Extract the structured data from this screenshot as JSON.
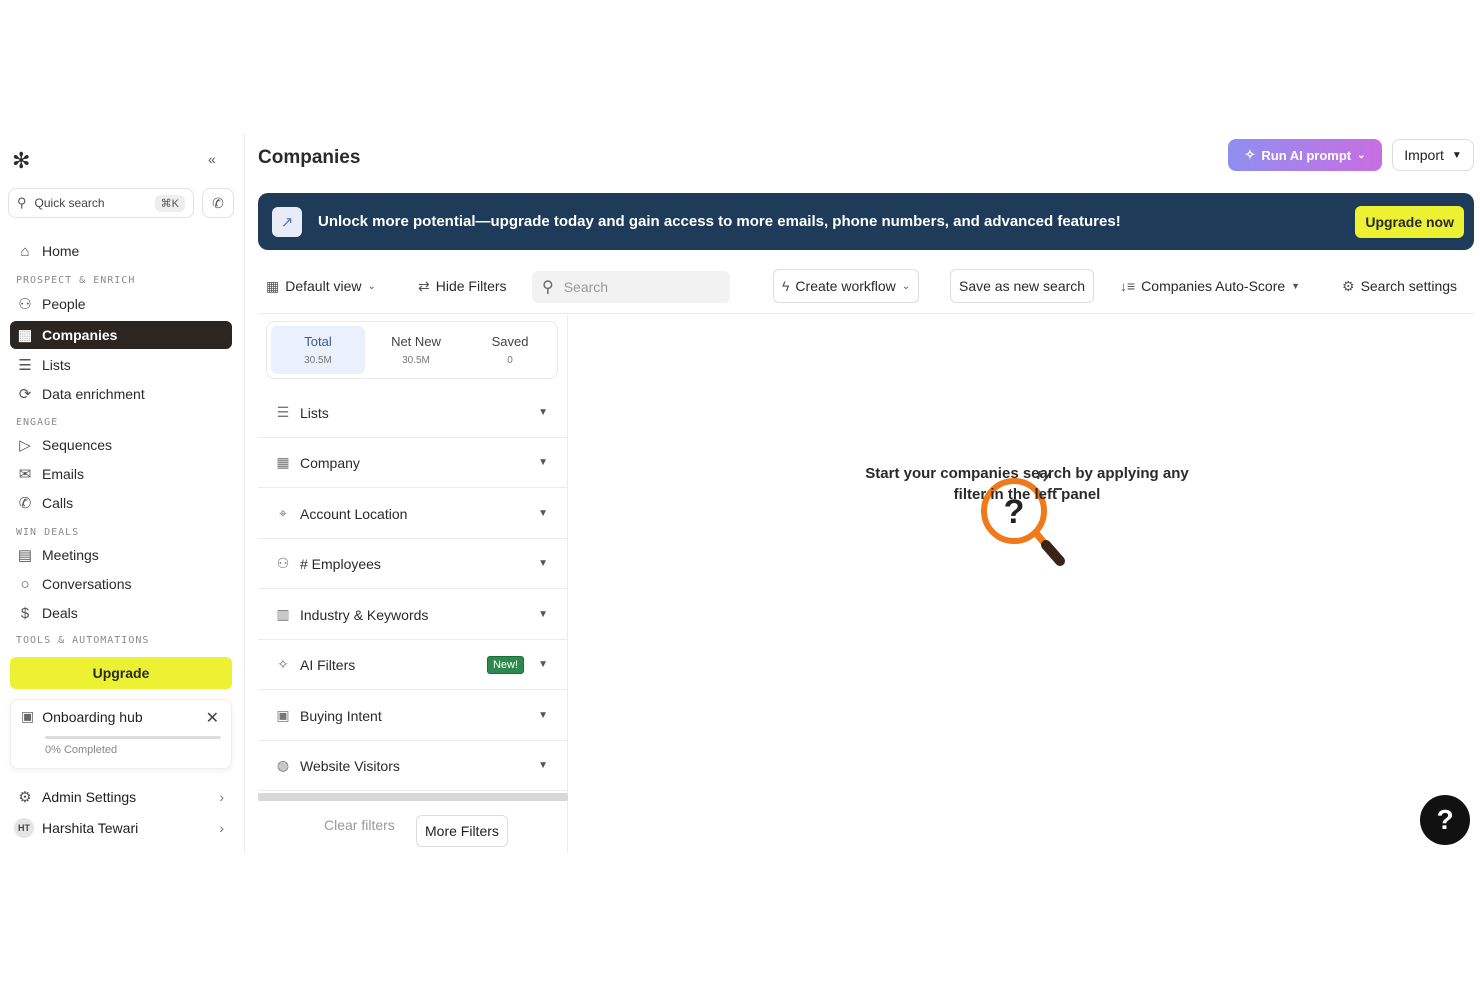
{
  "sidebar": {
    "collapse_icon": "«",
    "quick_search": {
      "placeholder": "Quick search",
      "shortcut": "⌘K"
    },
    "home": "Home",
    "sections": {
      "prospect": "PROSPECT & ENRICH",
      "engage": "ENGAGE",
      "win": "WIN DEALS",
      "tools": "TOOLS & AUTOMATIONS"
    },
    "items": {
      "people": "People",
      "companies": "Companies",
      "lists": "Lists",
      "data_enrichment": "Data enrichment",
      "sequences": "Sequences",
      "emails": "Emails",
      "calls": "Calls",
      "meetings": "Meetings",
      "conversations": "Conversations",
      "deals": "Deals"
    },
    "upgrade": "Upgrade",
    "onboarding": {
      "title": "Onboarding hub",
      "progress": "0% Completed",
      "progress_value": 0
    },
    "admin_settings": "Admin Settings",
    "user": {
      "initials": "HT",
      "name": "Harshita Tewari"
    }
  },
  "header": {
    "title": "Companies",
    "run_ai": "Run AI prompt",
    "import": "Import"
  },
  "banner": {
    "text": "Unlock more potential—upgrade today and gain access to more emails, phone numbers, and advanced features!",
    "button": "Upgrade now"
  },
  "toolbar": {
    "default_view": "Default view",
    "hide_filters": "Hide Filters",
    "search_placeholder": "Search",
    "create_workflow": "Create workflow",
    "save_search": "Save as new search",
    "auto_score": "Companies Auto-Score",
    "search_settings": "Search settings"
  },
  "stats": [
    {
      "label": "Total",
      "value": "30.5M"
    },
    {
      "label": "Net New",
      "value": "30.5M"
    },
    {
      "label": "Saved",
      "value": "0"
    }
  ],
  "filters": [
    {
      "label": "Lists",
      "icon": "list-icon"
    },
    {
      "label": "Company",
      "icon": "building-icon"
    },
    {
      "label": "Account Location",
      "icon": "location-pin-icon"
    },
    {
      "label": "# Employees",
      "icon": "people-icon"
    },
    {
      "label": "Industry & Keywords",
      "icon": "industry-icon"
    },
    {
      "label": "AI Filters",
      "icon": "sparkle-icon",
      "badge": "New!"
    },
    {
      "label": "Buying Intent",
      "icon": "chart-icon"
    },
    {
      "label": "Website Visitors",
      "icon": "globe-icon"
    }
  ],
  "filter_actions": {
    "clear": "Clear filters",
    "more": "More Filters"
  },
  "empty_state": {
    "line1": "Start your companies search by applying any",
    "line2": "filter in the left panel"
  },
  "help": "?",
  "colors": {
    "accent_yellow": "#ecf132",
    "banner_bg": "#1e3b59",
    "active_nav": "#2c2623",
    "magnifier": "#f07a1a"
  }
}
